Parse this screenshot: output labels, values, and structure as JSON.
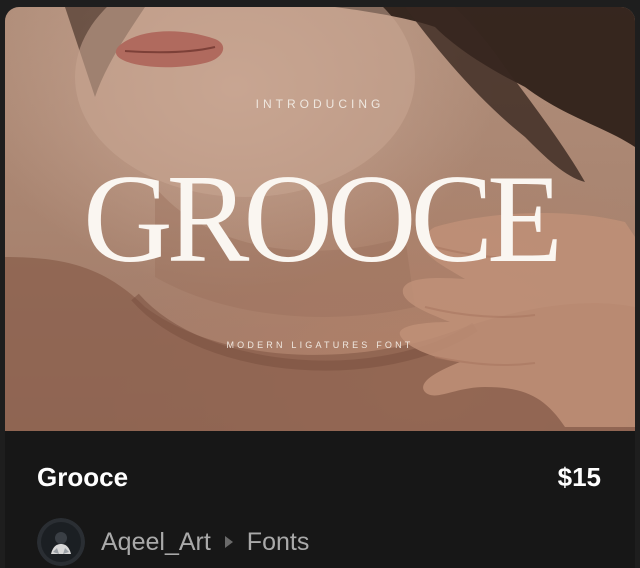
{
  "product": {
    "name": "Grooce",
    "price": "$15",
    "author": "Aqeel_Art",
    "category": "Fonts"
  },
  "preview": {
    "intro_text": "INTRODUCING",
    "title_text": "GROOCE",
    "subtitle_text": "MODERN LIGATURES FONT"
  },
  "icons": {
    "breadcrumb_separator": "caret-right-icon",
    "avatar": "author-avatar"
  },
  "colors": {
    "card_background": "#171717",
    "preview_tone": "#a8836f",
    "title_text": "#ffffff",
    "meta_text": "#a9a9a9"
  }
}
